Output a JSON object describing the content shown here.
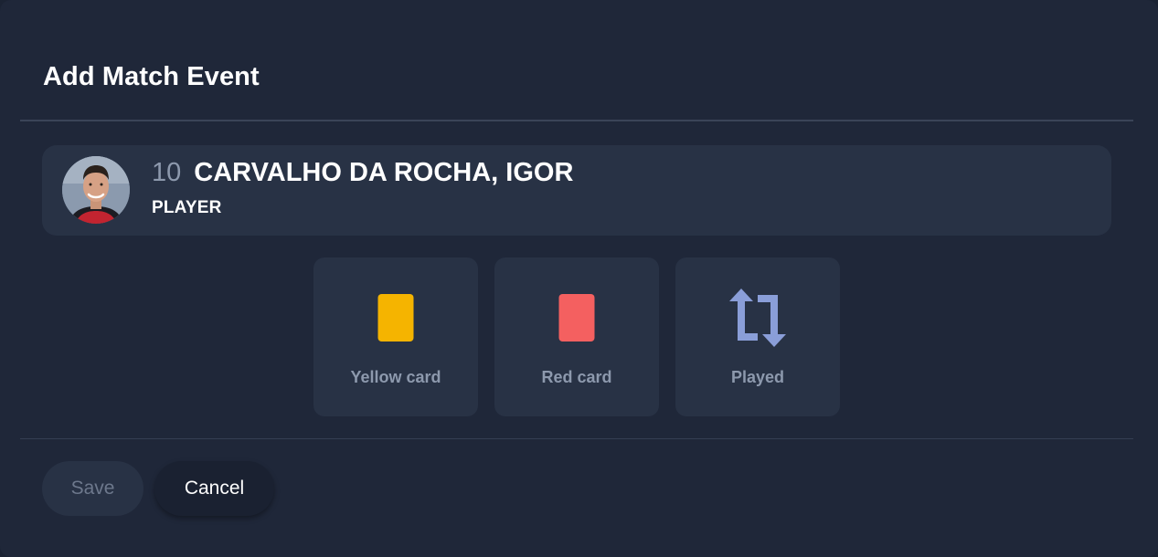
{
  "dialog": {
    "title": "Add Match Event"
  },
  "player": {
    "number": "10",
    "name": "CARVALHO DA ROCHA, IGOR",
    "role": "PLAYER"
  },
  "events": [
    {
      "label": "Yellow card",
      "icon": "yellow-card-icon",
      "color": "#f5b400"
    },
    {
      "label": "Red card",
      "icon": "red-card-icon",
      "color": "#f46060"
    },
    {
      "label": "Played",
      "icon": "swap-arrows-icon",
      "color": "#8a9ed8"
    }
  ],
  "actions": {
    "save_label": "Save",
    "cancel_label": "Cancel"
  },
  "colors": {
    "background": "#1f2739",
    "panel": "#283245",
    "muted_text": "#8d99ad"
  }
}
